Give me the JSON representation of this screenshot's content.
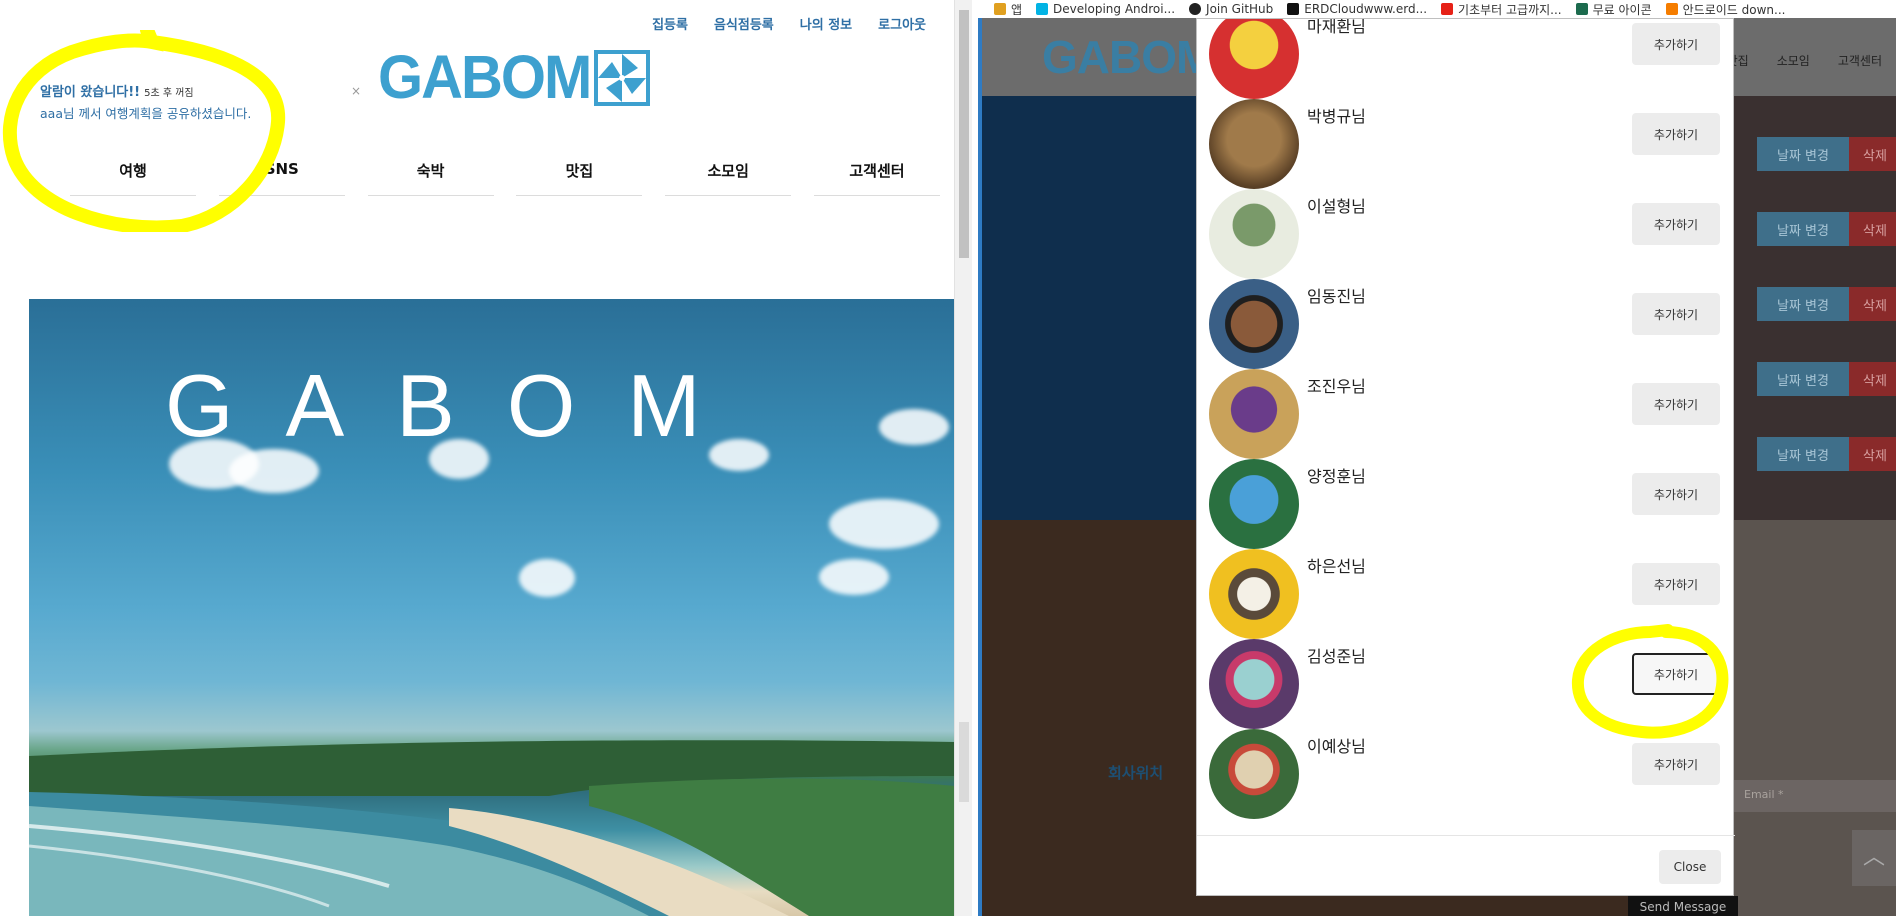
{
  "left": {
    "top_links": [
      "집등록",
      "음식점등록",
      "나의 정보",
      "로그아웃"
    ],
    "logo_text": "GABOM",
    "notification": {
      "title": "알람이 왔습니다!!",
      "time": "5초 후 꺼짐",
      "body": "aaa님 께서 여행계획을 공유하셨습니다.",
      "close": "×"
    },
    "nav": [
      "여행",
      "SNS",
      "숙박",
      "맛집",
      "소모임",
      "고객센터"
    ],
    "hero_title": "GABOM"
  },
  "right": {
    "bookmarks": [
      {
        "label": "앱",
        "icon": "apps-icon",
        "color": "#e0a020"
      },
      {
        "label": "Developing Androi...",
        "icon": "udacity-icon",
        "color": "#02b3e4"
      },
      {
        "label": "Join GitHub",
        "icon": "github-icon",
        "color": "#222222"
      },
      {
        "label": "ERDCloudwww.erd...",
        "icon": "erd-icon",
        "color": "#111111"
      },
      {
        "label": "기초부터 고급까지...",
        "icon": "youtube-icon",
        "color": "#e62117"
      },
      {
        "label": "무료 아이콘",
        "icon": "flaticon-icon",
        "color": "#1c6b4e"
      },
      {
        "label": "안드로이드 down...",
        "icon": "blogger-icon",
        "color": "#f57d00"
      }
    ],
    "bg_logo": "GABOM",
    "bg_nav": [
      "맛집",
      "소모임",
      "고객센터"
    ],
    "bg_btn_date": "날짜 변경",
    "bg_btn_del": "삭제",
    "bg_footer_title": "회사위치",
    "bg_email_placeholder": "Email *",
    "bg_send": "Send Message",
    "bg_up": "︿",
    "modal": {
      "friends": [
        {
          "name": "마재환님",
          "button": "추가하기",
          "avatar": "yellow-character-avatar",
          "c1": "#f4d03f",
          "c2": "#d63030"
        },
        {
          "name": "박병규님",
          "button": "추가하기",
          "avatar": "lion-avatar",
          "c1": "#a07a4a",
          "c2": "#5b4126"
        },
        {
          "name": "이설형님",
          "button": "추가하기",
          "avatar": "creature-avatar",
          "c1": "#e8ece0",
          "c2": "#7a9a6a"
        },
        {
          "name": "임동진님",
          "button": "추가하기",
          "avatar": "boy-cartoon-avatar",
          "c1": "#3a5f86",
          "c2": "#8a5a3a"
        },
        {
          "name": "조진우님",
          "button": "추가하기",
          "avatar": "thanos-avatar",
          "c1": "#c9a25a",
          "c2": "#6a3c8a"
        },
        {
          "name": "양정훈님",
          "button": "추가하기",
          "avatar": "blue-cat-avatar",
          "c1": "#4aa0d8",
          "c2": "#2a7040"
        },
        {
          "name": "하은선님",
          "button": "추가하기",
          "avatar": "gromit-avatar",
          "c1": "#f0c020",
          "c2": "#5a4a3a"
        },
        {
          "name": "김성준님",
          "button": "추가하기",
          "avatar": "fantasy-creature-avatar",
          "c1": "#5a3a6a",
          "c2": "#9ad0d0",
          "active": true
        },
        {
          "name": "이예상님",
          "button": "추가하기",
          "avatar": "cartoon-bird-avatar",
          "c1": "#3a6a3a",
          "c2": "#e0d0b0"
        }
      ],
      "close": "Close"
    }
  },
  "colors": {
    "accent": "#3da0cf",
    "highlight": "#ffff00",
    "link": "#2f6fa5"
  }
}
